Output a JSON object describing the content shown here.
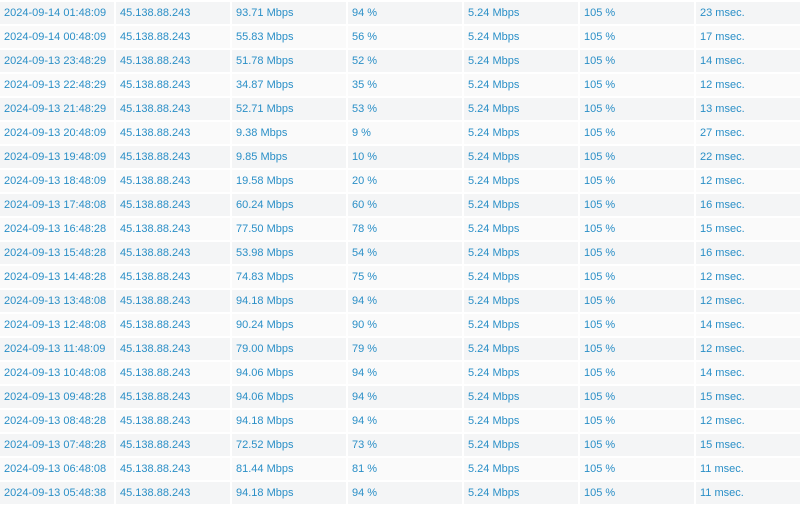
{
  "table": {
    "rows": [
      {
        "datetime": "2024-09-14 01:48:09",
        "ip": "45.138.88.243",
        "download": "93.71 Mbps",
        "download_pct": "94 %",
        "upload": "5.24 Mbps",
        "upload_pct": "105 %",
        "ping": "23 msec."
      },
      {
        "datetime": "2024-09-14 00:48:09",
        "ip": "45.138.88.243",
        "download": "55.83 Mbps",
        "download_pct": "56 %",
        "upload": "5.24 Mbps",
        "upload_pct": "105 %",
        "ping": "17 msec."
      },
      {
        "datetime": "2024-09-13 23:48:29",
        "ip": "45.138.88.243",
        "download": "51.78 Mbps",
        "download_pct": "52 %",
        "upload": "5.24 Mbps",
        "upload_pct": "105 %",
        "ping": "14 msec."
      },
      {
        "datetime": "2024-09-13 22:48:29",
        "ip": "45.138.88.243",
        "download": "34.87 Mbps",
        "download_pct": "35 %",
        "upload": "5.24 Mbps",
        "upload_pct": "105 %",
        "ping": "12 msec."
      },
      {
        "datetime": "2024-09-13 21:48:29",
        "ip": "45.138.88.243",
        "download": "52.71 Mbps",
        "download_pct": "53 %",
        "upload": "5.24 Mbps",
        "upload_pct": "105 %",
        "ping": "13 msec."
      },
      {
        "datetime": "2024-09-13 20:48:09",
        "ip": "45.138.88.243",
        "download": "9.38 Mbps",
        "download_pct": "9 %",
        "upload": "5.24 Mbps",
        "upload_pct": "105 %",
        "ping": "27 msec."
      },
      {
        "datetime": "2024-09-13 19:48:09",
        "ip": "45.138.88.243",
        "download": "9.85 Mbps",
        "download_pct": "10 %",
        "upload": "5.24 Mbps",
        "upload_pct": "105 %",
        "ping": "22 msec."
      },
      {
        "datetime": "2024-09-13 18:48:09",
        "ip": "45.138.88.243",
        "download": "19.58 Mbps",
        "download_pct": "20 %",
        "upload": "5.24 Mbps",
        "upload_pct": "105 %",
        "ping": "12 msec."
      },
      {
        "datetime": "2024-09-13 17:48:08",
        "ip": "45.138.88.243",
        "download": "60.24 Mbps",
        "download_pct": "60 %",
        "upload": "5.24 Mbps",
        "upload_pct": "105 %",
        "ping": "16 msec."
      },
      {
        "datetime": "2024-09-13 16:48:28",
        "ip": "45.138.88.243",
        "download": "77.50 Mbps",
        "download_pct": "78 %",
        "upload": "5.24 Mbps",
        "upload_pct": "105 %",
        "ping": "15 msec."
      },
      {
        "datetime": "2024-09-13 15:48:28",
        "ip": "45.138.88.243",
        "download": "53.98 Mbps",
        "download_pct": "54 %",
        "upload": "5.24 Mbps",
        "upload_pct": "105 %",
        "ping": "16 msec."
      },
      {
        "datetime": "2024-09-13 14:48:28",
        "ip": "45.138.88.243",
        "download": "74.83 Mbps",
        "download_pct": "75 %",
        "upload": "5.24 Mbps",
        "upload_pct": "105 %",
        "ping": "12 msec."
      },
      {
        "datetime": "2024-09-13 13:48:08",
        "ip": "45.138.88.243",
        "download": "94.18 Mbps",
        "download_pct": "94 %",
        "upload": "5.24 Mbps",
        "upload_pct": "105 %",
        "ping": "12 msec."
      },
      {
        "datetime": "2024-09-13 12:48:08",
        "ip": "45.138.88.243",
        "download": "90.24 Mbps",
        "download_pct": "90 %",
        "upload": "5.24 Mbps",
        "upload_pct": "105 %",
        "ping": "14 msec."
      },
      {
        "datetime": "2024-09-13 11:48:09",
        "ip": "45.138.88.243",
        "download": "79.00 Mbps",
        "download_pct": "79 %",
        "upload": "5.24 Mbps",
        "upload_pct": "105 %",
        "ping": "12 msec."
      },
      {
        "datetime": "2024-09-13 10:48:08",
        "ip": "45.138.88.243",
        "download": "94.06 Mbps",
        "download_pct": "94 %",
        "upload": "5.24 Mbps",
        "upload_pct": "105 %",
        "ping": "14 msec."
      },
      {
        "datetime": "2024-09-13 09:48:28",
        "ip": "45.138.88.243",
        "download": "94.06 Mbps",
        "download_pct": "94 %",
        "upload": "5.24 Mbps",
        "upload_pct": "105 %",
        "ping": "15 msec."
      },
      {
        "datetime": "2024-09-13 08:48:28",
        "ip": "45.138.88.243",
        "download": "94.18 Mbps",
        "download_pct": "94 %",
        "upload": "5.24 Mbps",
        "upload_pct": "105 %",
        "ping": "12 msec."
      },
      {
        "datetime": "2024-09-13 07:48:28",
        "ip": "45.138.88.243",
        "download": "72.52 Mbps",
        "download_pct": "73 %",
        "upload": "5.24 Mbps",
        "upload_pct": "105 %",
        "ping": "15 msec."
      },
      {
        "datetime": "2024-09-13 06:48:08",
        "ip": "45.138.88.243",
        "download": "81.44 Mbps",
        "download_pct": "81 %",
        "upload": "5.24 Mbps",
        "upload_pct": "105 %",
        "ping": "11 msec."
      },
      {
        "datetime": "2024-09-13 05:48:38",
        "ip": "45.138.88.243",
        "download": "94.18 Mbps",
        "download_pct": "94 %",
        "upload": "5.24 Mbps",
        "upload_pct": "105 %",
        "ping": "11 msec."
      }
    ]
  },
  "colors": {
    "text": "#2a8fc7",
    "row_odd": "#f4f5f6",
    "row_even": "#fafafa"
  }
}
